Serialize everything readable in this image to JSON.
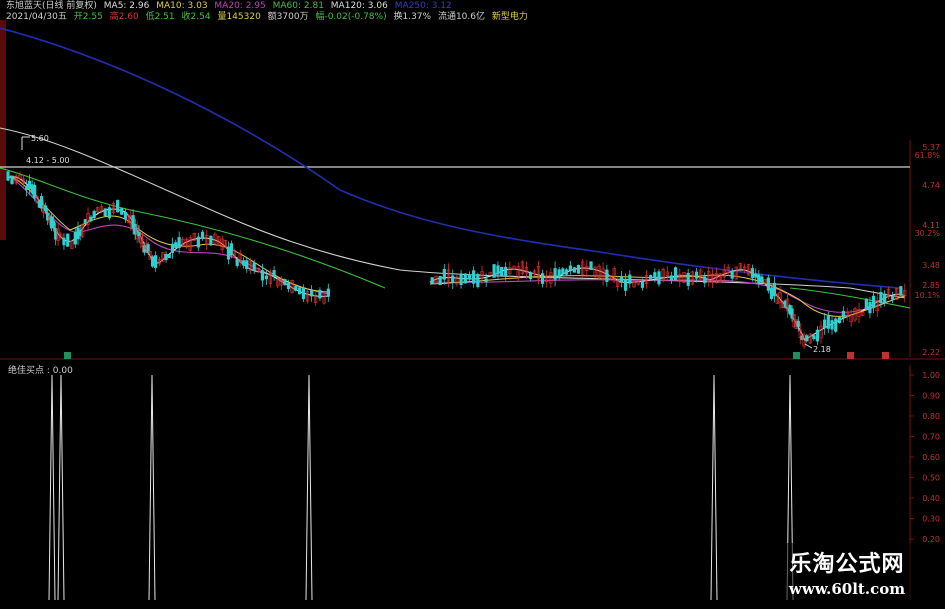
{
  "header": {
    "title": "东旭蓝天(日线 前复权)",
    "ma5": "MA5: 2.96",
    "ma10": "MA10: 3.03",
    "ma20": "MA20: 2.95",
    "ma60": "MA60: 2.81",
    "ma120": "MA120: 3.06",
    "ma250": "MA250: 3.12",
    "date": "2021/04/30五",
    "open": "开2.55",
    "high": "高2.60",
    "low": "低2.51",
    "close": "收2.54",
    "volume": "量145320",
    "amount": "额3700万",
    "change": "幅-0.02(-0.78%)",
    "turnover": "换1.37%",
    "float": "流通10.6亿",
    "sector": "新型电力"
  },
  "colors": {
    "ma5": "#d8d8d8",
    "ma10": "#e0d040",
    "ma20": "#d040d0",
    "ma60": "#40c040",
    "ma120": "#1f2fb0",
    "ma250": "#d8d8d8",
    "up": "#e03030",
    "down": "#30d0d0",
    "axis": "#7a1010",
    "hline": "#cfcfcf"
  },
  "right_axis": {
    "labels": [
      "5.37",
      "61.8%",
      "4.74",
      "4.11",
      "30.2%",
      "3.48",
      "2.85",
      "10.1%",
      "2.22"
    ]
  },
  "annotations": {
    "high_mark": "5.60",
    "range_mark": "4.12 - 5.00",
    "low_mark": "2.18"
  },
  "sub_chart": {
    "label": "绝佳买点 : 0.00",
    "axis_labels": [
      "1.00",
      "0.90",
      "0.80",
      "0.70",
      "0.60",
      "0.50",
      "0.40",
      "0.30",
      "0.20"
    ]
  },
  "watermark": {
    "title": "乐淘公式网",
    "url": "www.60lt.com"
  },
  "chart_data": [
    {
      "type": "line",
      "title": "东旭蓝天(日线 前复权)",
      "ylim": [
        2.0,
        5.5
      ],
      "series": [
        {
          "name": "MA120",
          "x": [
            0,
            50,
            100,
            200,
            300,
            400,
            500,
            600,
            700,
            800,
            900
          ],
          "y": [
            6.6,
            6.3,
            6.0,
            5.3,
            4.55,
            4.15,
            3.8,
            3.6,
            3.45,
            3.32,
            3.12
          ]
        },
        {
          "name": "MA250",
          "x": [
            0,
            50,
            100,
            200,
            300,
            380
          ],
          "y": [
            5.0,
            4.8,
            4.5,
            4.0,
            3.6,
            3.3
          ]
        },
        {
          "name": "MA60",
          "x": [
            0,
            50,
            100,
            200,
            300,
            380
          ],
          "y": [
            4.6,
            4.3,
            4.1,
            3.75,
            3.4,
            3.15
          ]
        },
        {
          "name": "MA5",
          "x": [
            0,
            30,
            60,
            90,
            120,
            150,
            180,
            210,
            240,
            270,
            300,
            330
          ],
          "y": [
            4.4,
            4.25,
            3.8,
            4.0,
            3.7,
            3.4,
            3.5,
            3.7,
            3.3,
            3.25,
            3.05,
            3.05
          ]
        }
      ]
    },
    {
      "type": "bar",
      "title": "绝佳买点",
      "ylim": [
        0.2,
        1.0
      ],
      "x": [
        52,
        61,
        152,
        309,
        714,
        790
      ],
      "values": [
        1.0,
        1.0,
        1.0,
        1.0,
        1.0,
        1.0
      ]
    }
  ]
}
